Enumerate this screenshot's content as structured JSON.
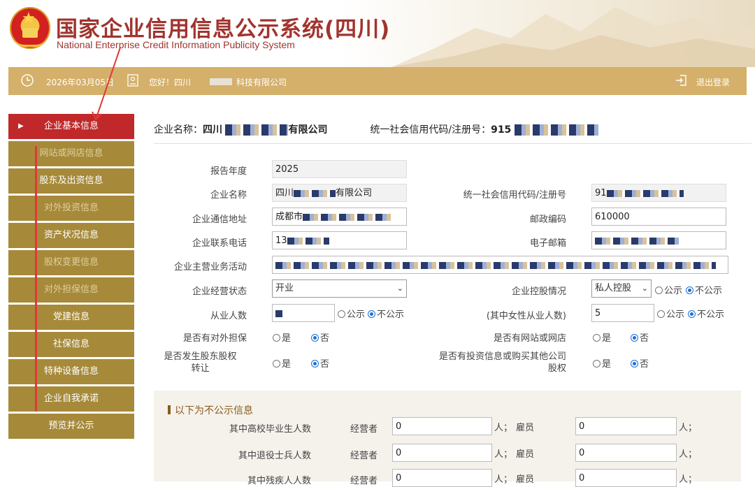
{
  "header": {
    "title_cn": "国家企业信用信息公示系统(四川)",
    "title_en": "National Enterprise Credit Information Publicity System"
  },
  "topbar": {
    "date": "2026年03月05日",
    "greeting": "您好！四川",
    "company_suffix": "科技有限公司",
    "logout": "退出登录",
    "icons": [
      "clock-icon",
      "user-card-icon",
      "logout-icon"
    ]
  },
  "sidebar": {
    "items": [
      {
        "label": "企业基本信息",
        "active": true
      },
      {
        "label": "网站或网店信息",
        "dim": true
      },
      {
        "label": "股东及出资信息"
      },
      {
        "label": "对外投资信息",
        "dim": true
      },
      {
        "label": "资产状况信息"
      },
      {
        "label": "股权变更信息",
        "dim": true
      },
      {
        "label": "对外担保信息",
        "dim": true
      },
      {
        "label": "党建信息"
      },
      {
        "label": "社保信息"
      },
      {
        "label": "特种设备信息"
      },
      {
        "label": "企业自我承诺"
      },
      {
        "label": "预览并公示"
      }
    ]
  },
  "company_header": {
    "name_label": "企业名称：",
    "name_prefix": "四川",
    "name_suffix": "有限公司",
    "code_label": "统一社会信用代码/注册号：",
    "code_prefix": "915"
  },
  "form": {
    "report_year_label": "报告年度",
    "report_year": "2025",
    "company_name_label": "企业名称",
    "company_name_prefix": "四川",
    "company_name_suffix": "有限公司",
    "credit_code_label": "统一社会信用代码/注册号",
    "credit_code_prefix": "91",
    "address_label": "企业通信地址",
    "address_prefix": "成都市",
    "postal_label": "邮政编码",
    "postal_code": "610000",
    "phone_label": "企业联系电话",
    "phone_prefix": "13",
    "email_label": "电子邮箱",
    "business_label": "企业主营业务活动",
    "status_label": "企业经营状态",
    "status_value": "开业",
    "control_label": "企业控股情况",
    "control_value": "私人控股",
    "employees_label": "从业人数",
    "female_label": "(其中女性从业人数)",
    "female_prefix": "5",
    "public": "公示",
    "not_public": "不公示",
    "guarantee_label": "是否有对外担保",
    "website_label": "是否有网站或网店",
    "equity_transfer_label_1": "是否发生股东股权",
    "equity_transfer_label_2": "转让",
    "investment_label_1": "是否有投资信息或购买其他公司",
    "investment_label_2": "股权",
    "yes": "是",
    "no": "否"
  },
  "private_panel": {
    "title": "以下为不公示信息",
    "rows": [
      {
        "label": "其中高校毕业生人数",
        "operator_label": "经营者",
        "operator_value": "0",
        "employee_label": "雇员",
        "employee_value": "0"
      },
      {
        "label": "其中退役士兵人数",
        "operator_label": "经营者",
        "operator_value": "0",
        "employee_label": "雇员",
        "employee_value": "0"
      },
      {
        "label": "其中残疾人人数",
        "operator_label": "经营者",
        "operator_value": "0",
        "employee_label": "雇员",
        "employee_value": "0"
      }
    ],
    "unit_sep": "人；",
    "unit_end": "人；"
  },
  "colors": {
    "brand_red": "#a1342e",
    "bar_gold": "#d4b06a",
    "side_gold": "#a68a3a",
    "active_red": "#c0282a"
  }
}
